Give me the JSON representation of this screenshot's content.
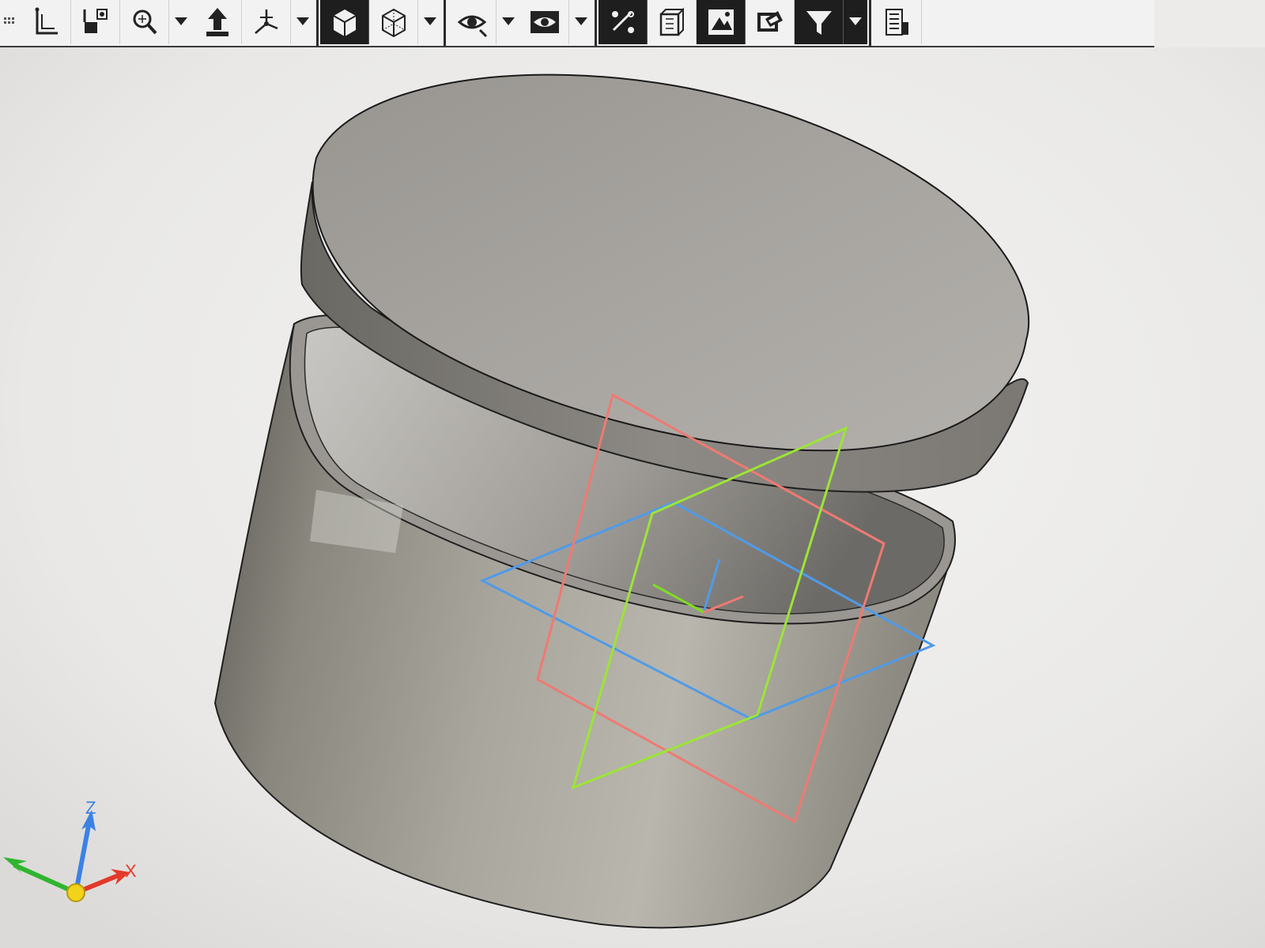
{
  "toolbar": {
    "buttons": [
      {
        "name": "sketch-corner-icon"
      },
      {
        "name": "dimension-icon"
      },
      {
        "name": "zoom-icon",
        "dropdown": true
      },
      {
        "name": "arrow-up-icon"
      },
      {
        "name": "view-orient-icon",
        "dropdown": true
      },
      {
        "name": "shaded-cube-icon",
        "dark": true
      },
      {
        "name": "wireframe-cube-icon",
        "dropdown": true
      },
      {
        "name": "hide-show-icon",
        "dropdown": true
      },
      {
        "name": "eye-icon",
        "dropdown": true
      },
      {
        "name": "appearance-icon",
        "dark": true
      },
      {
        "name": "section-view-icon"
      },
      {
        "name": "scene-icon",
        "dark": true
      },
      {
        "name": "render-icon"
      },
      {
        "name": "filter-icon",
        "dark": true,
        "dropdown": true
      },
      {
        "name": "view-settings-icon"
      }
    ]
  },
  "colors": {
    "background": "#ecebea",
    "body": "#8e8b84",
    "front_plane": "#4f9be8",
    "top_plane": "#9ce536",
    "right_plane": "#ee7a72",
    "axis_x": "#e23a2a",
    "axis_y": "#2fb52f",
    "axis_z": "#3b82e6"
  },
  "triad": {
    "x_label": "X",
    "z_label": "Z"
  }
}
